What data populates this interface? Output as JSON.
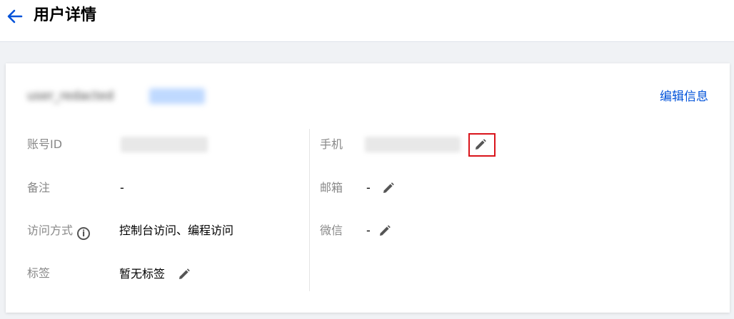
{
  "header": {
    "title": "用户详情"
  },
  "user": {
    "edit_info_label": "编辑信息"
  },
  "fields_left": [
    {
      "label": "账号ID",
      "value": ""
    },
    {
      "label": "备注",
      "value": "-"
    },
    {
      "label": "访问方式",
      "value": "控制台访问、编程访问"
    },
    {
      "label": "标签",
      "value": "暂无标签"
    }
  ],
  "fields_right": [
    {
      "label": "手机",
      "value": ""
    },
    {
      "label": "邮箱",
      "value": "-"
    },
    {
      "label": "微信",
      "value": "-"
    }
  ],
  "icons": {
    "back": "arrow-left-icon",
    "edit": "pencil-icon",
    "info": "info-circle-icon"
  },
  "colors": {
    "accent": "#0052d9",
    "highlight": "#d9141b"
  }
}
